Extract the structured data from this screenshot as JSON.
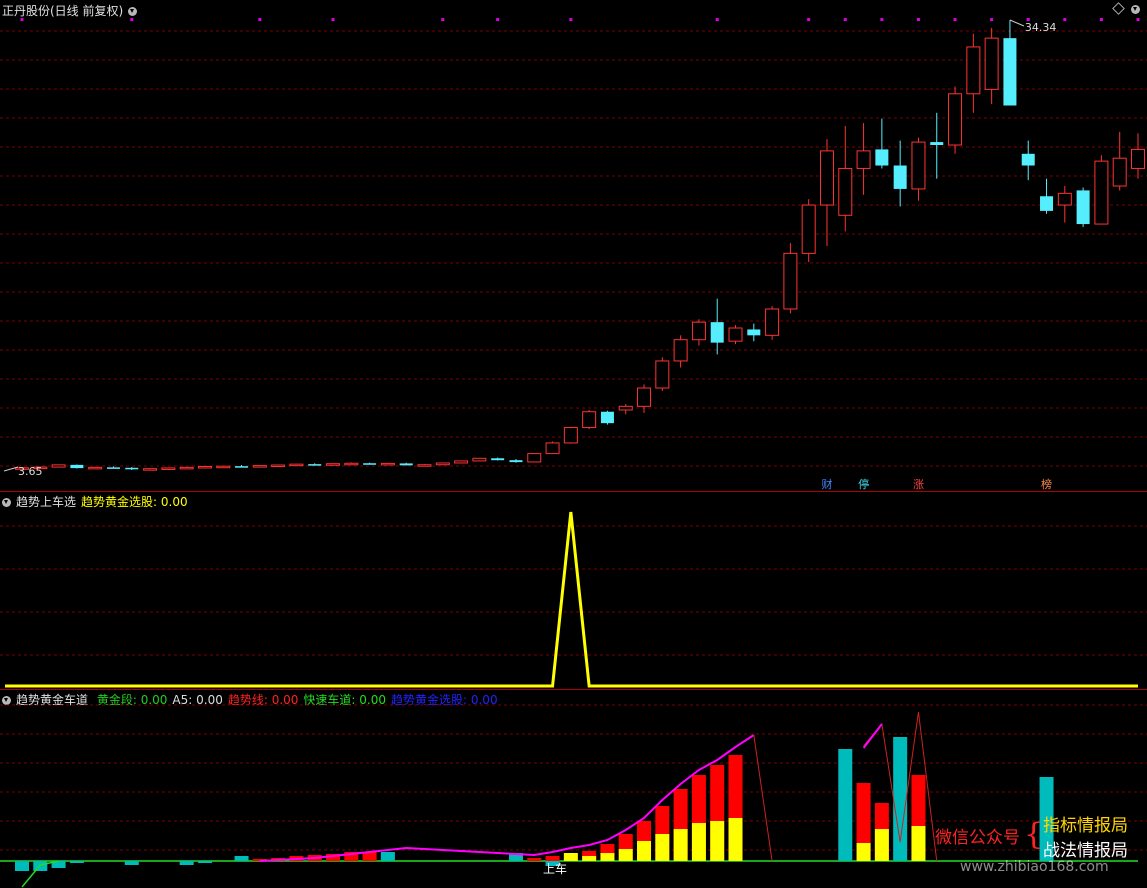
{
  "main": {
    "title": "正丹股份(日线 前复权)",
    "high_label": "34.34",
    "low_label": "3.65",
    "tags": [
      {
        "text": "财",
        "color": "#4488ff"
      },
      {
        "text": "停",
        "color": "#44ddee"
      },
      {
        "text": "涨",
        "color": "#ff4444"
      },
      {
        "text": "榜",
        "color": "#ff8844"
      }
    ]
  },
  "sub1": {
    "title": "趋势上车选",
    "line_label": "趋势黄金选股: 0.00"
  },
  "sub2": {
    "title": "趋势黄金车道",
    "items": [
      {
        "text": "黄金段: 0.00",
        "color": "#22cc22"
      },
      {
        "text": "A5: 0.00",
        "color": "#dddddd"
      },
      {
        "text": "趋势线: 0.00",
        "color": "#ff2222"
      },
      {
        "text": "快速车道: 0.00",
        "color": "#22dd22"
      },
      {
        "text": "趋势黄金选股: 0.00",
        "color": "#2222ff"
      }
    ],
    "signal_label": "上车"
  },
  "watermark": {
    "wechat": "微信公众号",
    "brace": "{",
    "line1": "指标情报局",
    "line2": "战法情报局",
    "url": "www.zhibiao168.com"
  },
  "colors": {
    "up": "#ff3333",
    "down": "#55eeff",
    "grid": "#7a0000",
    "gold_line": "#ffff00",
    "trend": "#ff00ff",
    "fast_lane": "#22dd22",
    "bar_red": "#ff0000",
    "bar_yellow": "#ffff00",
    "bar_teal": "#00bbbb"
  },
  "chart_data": [
    {
      "type": "candlestick",
      "title": "正丹股份(日线 前复权)",
      "ohlc": [
        [
          3.7,
          3.78,
          3.65,
          3.75
        ],
        [
          3.75,
          3.82,
          3.7,
          3.8
        ],
        [
          3.8,
          3.98,
          3.78,
          3.95
        ],
        [
          3.95,
          3.98,
          3.7,
          3.73
        ],
        [
          3.73,
          3.82,
          3.68,
          3.78
        ],
        [
          3.78,
          3.85,
          3.72,
          3.75
        ],
        [
          3.75,
          3.8,
          3.6,
          3.65
        ],
        [
          3.65,
          3.72,
          3.6,
          3.69
        ],
        [
          3.69,
          3.78,
          3.65,
          3.74
        ],
        [
          3.74,
          3.82,
          3.7,
          3.78
        ],
        [
          3.78,
          3.86,
          3.75,
          3.84
        ],
        [
          3.84,
          3.9,
          3.8,
          3.86
        ],
        [
          3.86,
          3.94,
          3.8,
          3.82
        ],
        [
          3.82,
          3.92,
          3.8,
          3.9
        ],
        [
          3.9,
          3.98,
          3.86,
          3.94
        ],
        [
          3.94,
          4.02,
          3.9,
          4.0
        ],
        [
          4.0,
          4.06,
          3.94,
          3.97
        ],
        [
          3.97,
          4.06,
          3.94,
          4.03
        ],
        [
          4.03,
          4.12,
          4.0,
          4.06
        ],
        [
          4.06,
          4.1,
          3.98,
          4.0
        ],
        [
          4.0,
          4.08,
          3.96,
          4.05
        ],
        [
          4.05,
          4.1,
          3.9,
          3.92
        ],
        [
          3.92,
          4.0,
          3.86,
          3.96
        ],
        [
          3.96,
          4.1,
          3.94,
          4.08
        ],
        [
          4.08,
          4.25,
          4.05,
          4.22
        ],
        [
          4.22,
          4.42,
          4.2,
          4.4
        ],
        [
          4.4,
          4.45,
          4.25,
          4.27
        ],
        [
          4.27,
          4.35,
          4.1,
          4.14
        ],
        [
          4.15,
          4.75,
          4.12,
          4.72
        ],
        [
          4.72,
          5.55,
          4.7,
          5.45
        ],
        [
          5.45,
          6.55,
          5.4,
          6.5
        ],
        [
          6.5,
          7.7,
          6.4,
          7.58
        ],
        [
          7.58,
          7.65,
          6.7,
          6.8
        ],
        [
          7.7,
          8.1,
          7.4,
          7.95
        ],
        [
          7.95,
          9.45,
          7.5,
          9.2
        ],
        [
          9.2,
          11.3,
          9.0,
          11.05
        ],
        [
          11.05,
          12.8,
          10.6,
          12.5
        ],
        [
          12.5,
          13.9,
          12.1,
          13.7
        ],
        [
          13.7,
          15.3,
          11.5,
          12.3
        ],
        [
          12.4,
          13.5,
          12.2,
          13.3
        ],
        [
          13.2,
          13.6,
          12.4,
          12.8
        ],
        [
          12.8,
          14.8,
          12.5,
          14.6
        ],
        [
          14.6,
          19.1,
          14.3,
          18.4
        ],
        [
          18.4,
          22.1,
          17.8,
          21.7
        ],
        [
          21.7,
          26.2,
          18.9,
          25.4
        ],
        [
          21.0,
          27.1,
          19.9,
          24.2
        ],
        [
          24.2,
          27.3,
          22.4,
          25.4
        ],
        [
          25.5,
          27.6,
          24.2,
          24.4
        ],
        [
          24.4,
          26.1,
          21.6,
          22.8
        ],
        [
          22.8,
          26.3,
          22.0,
          26.0
        ],
        [
          26.0,
          28.0,
          23.5,
          25.8
        ],
        [
          25.8,
          29.8,
          25.2,
          29.3
        ],
        [
          29.3,
          33.4,
          28.0,
          32.5
        ],
        [
          29.6,
          33.8,
          28.6,
          33.1
        ],
        [
          33.1,
          34.34,
          30.1,
          28.5
        ],
        [
          25.2,
          26.1,
          23.4,
          24.4
        ],
        [
          22.3,
          23.5,
          21.1,
          21.3
        ],
        [
          21.7,
          23.0,
          20.5,
          22.5
        ],
        [
          22.7,
          22.9,
          20.2,
          20.4
        ],
        [
          20.4,
          25.1,
          20.4,
          24.7
        ],
        [
          23.0,
          26.7,
          22.7,
          24.9
        ],
        [
          24.2,
          26.6,
          23.5,
          25.5
        ]
      ]
    },
    {
      "type": "line",
      "title": "趋势上车选",
      "series": [
        {
          "name": "趋势黄金选股",
          "peak": 1,
          "baseline": 0
        }
      ]
    },
    {
      "type": "bar",
      "title": "趋势黄金车道"
    }
  ]
}
